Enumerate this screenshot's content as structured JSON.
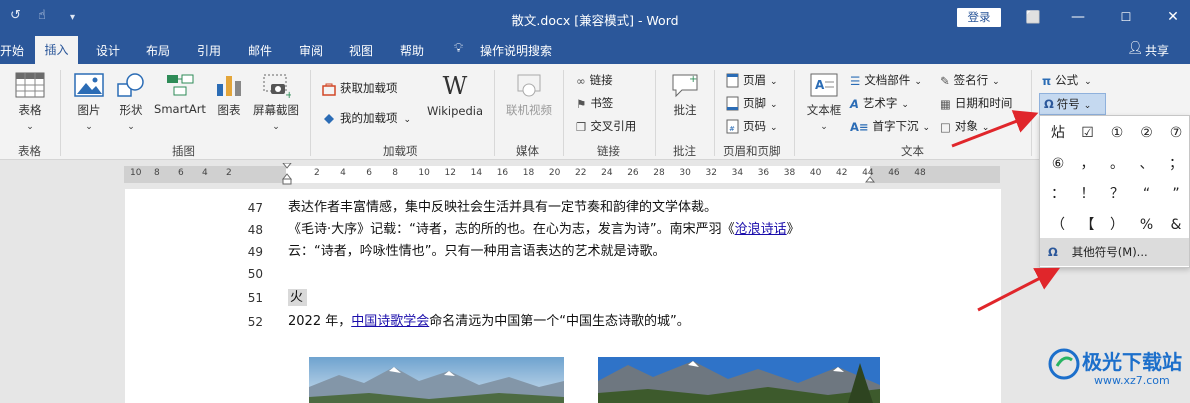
{
  "titlebar": {
    "title": "散文.docx [兼容模式]  -  Word",
    "login": "登录",
    "colors": {
      "brand": "#2b579a"
    }
  },
  "tabs": {
    "file_partial": "开始",
    "items": [
      "插入",
      "设计",
      "布局",
      "引用",
      "邮件",
      "审阅",
      "视图",
      "帮助"
    ],
    "search": "操作说明搜索",
    "share": "共享"
  },
  "ribbon": {
    "groups": {
      "table": "表格",
      "illustrations": "插图",
      "addins": "加载项",
      "media": "媒体",
      "links": "链接",
      "comments": "批注",
      "header_footer": "页眉和页脚",
      "text": "文本"
    },
    "buttons": {
      "table": "表格",
      "picture": "图片",
      "shapes": "形状",
      "smartart": "SmartArt",
      "chart": "图表",
      "screenshot": "屏幕截图",
      "get_addins": "获取加载项",
      "my_addins": "我的加载项",
      "wikipedia": "Wikipedia",
      "online_video": "联机视频",
      "link": "链接",
      "bookmark": "书签",
      "cross_ref": "交叉引用",
      "comment": "批注",
      "header": "页眉",
      "footer": "页脚",
      "page_num": "页码",
      "textbox": "文本框",
      "doc_parts": "文档部件",
      "wordart": "艺术字",
      "dropcap": "首字下沉",
      "signature": "签名行",
      "datetime": "日期和时间",
      "object": "对象",
      "equation": "公式",
      "symbol": "符号"
    }
  },
  "ruler": {
    "numbers": [
      "10",
      "8",
      "6",
      "4",
      "2",
      "2",
      "4",
      "6",
      "8",
      "10",
      "12",
      "14",
      "16",
      "18",
      "20",
      "22",
      "24",
      "26",
      "28",
      "30",
      "32",
      "34",
      "36",
      "38",
      "40",
      "42",
      "44",
      "46",
      "48"
    ]
  },
  "document": {
    "lines": [
      {
        "num": "47",
        "text": "表达作者丰富情感，集中反映社会生活并具有一定节奏和韵律的文学体裁。"
      },
      {
        "num": "48",
        "text_a": "《毛诗·大序》记载：“诗者，志的所的也。在心为志，发言为诗”。南宋严羽《",
        "link": "沧浪诗话",
        "text_b": "》"
      },
      {
        "num": "49",
        "text": "云：“诗者，吟咏性情也”。只有一种用言语表达的艺术就是诗歌。"
      },
      {
        "num": "50",
        "text": ""
      },
      {
        "num": "51",
        "text": "火"
      },
      {
        "num": "52",
        "text_a": "2022 年，",
        "link": "中国诗歌学会",
        "text_b": "命名清远为中国第一个“中国生态诗歌的城”。"
      }
    ]
  },
  "symbol_dropdown": {
    "symbols": [
      "炶",
      "☑",
      "①",
      "②",
      "⑦",
      "⑥",
      "，",
      "。",
      "、",
      "；",
      "：",
      "！",
      "？",
      "“",
      "”",
      "（",
      "【",
      "）",
      "%",
      "&"
    ],
    "more": "其他符号(M)..."
  },
  "watermark": {
    "name": "极光下载站",
    "url": "www.xz7.com"
  }
}
